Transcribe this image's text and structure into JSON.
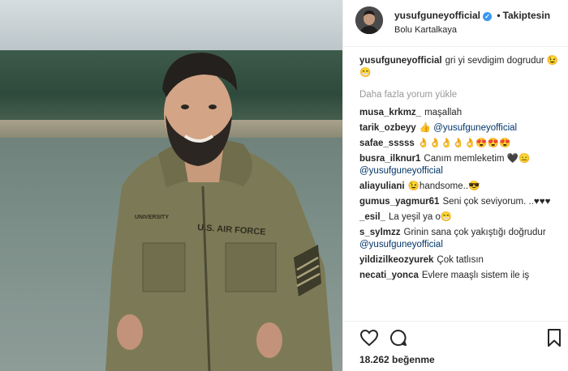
{
  "post": {
    "username": "yusufguneyofficial",
    "follow_label": "Takiptesin",
    "dot": "•",
    "verified_mark": "✓",
    "location": "Bolu Kartalkaya",
    "caption": "gri yi sevdigim dogrudur 😉😁",
    "load_more": "Daha fazla yorum yükle",
    "likes": "18.262 beğenme",
    "jacket_patch": "U.S. AIR FORCE",
    "jacket_name": "UNIVERSITY"
  },
  "comments": [
    {
      "user": "musa_krkmz_",
      "text": "maşallah"
    },
    {
      "user": "tarik_ozbeyy",
      "emoji": "👍",
      "mention": "@yusufguneyofficial"
    },
    {
      "user": "safae_sssss",
      "text": "👌👌👌👌👌😍😍😍"
    },
    {
      "user": "busra_ilknur1",
      "text": "Canım memleketim 🖤😑",
      "mention": "@yusufguneyofficial"
    },
    {
      "user": "aliayuliani",
      "text": "😉handsome..😎"
    },
    {
      "user": "gumus_yagmur61",
      "text": "Seni çok seviyorum. ..♥♥♥"
    },
    {
      "user": "_esil_",
      "text": "La yeşil ya o😁"
    },
    {
      "user": "s_sylmzz",
      "text": "Grinin sana çok yakıştığı doğrudur",
      "mention": "@yusufguneyofficial"
    },
    {
      "user": "yildizilkeozyurek",
      "text": "Çok tatlısın"
    },
    {
      "user": "necati_yonca",
      "text": "Evlere maaşlı sistem ile iş"
    }
  ],
  "icons": [
    "heart-icon",
    "comment-icon",
    "bookmark-icon"
  ],
  "colors": {
    "verified": "#3897f0",
    "mention": "#003569",
    "muted": "#999999"
  }
}
